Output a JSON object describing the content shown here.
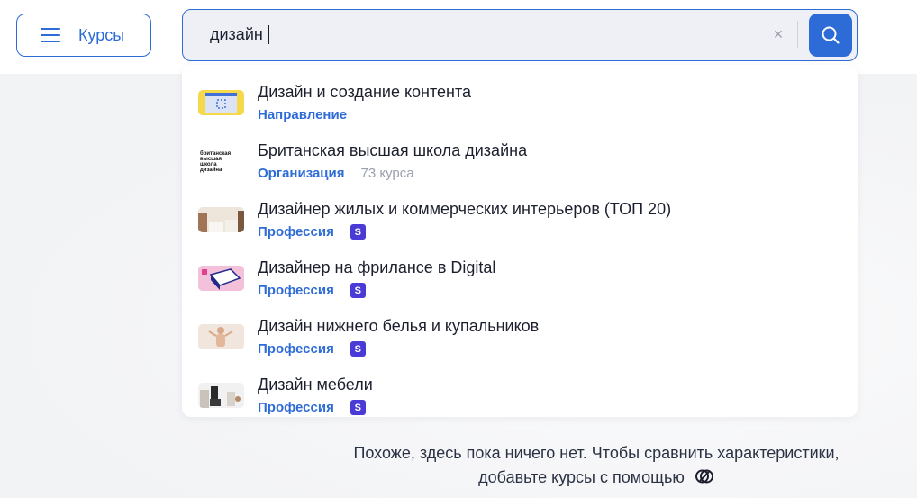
{
  "header": {
    "menu_button_label": "Курсы",
    "search": {
      "value": "дизайн",
      "placeholder": ""
    },
    "clear_symbol": "×"
  },
  "suggestions": [
    {
      "title": "Дизайн и создание контента",
      "type": "Направление",
      "count": "",
      "badge": ""
    },
    {
      "title": "Британская высшая школа дизайна",
      "type": "Организация",
      "count": "73 курса",
      "badge": "",
      "logo_text": "британская высшая школа дизайна"
    },
    {
      "title": "Дизайнер жилых и коммерческих интерьеров (ТОП 20)",
      "type": "Профессия",
      "count": "",
      "badge": "S"
    },
    {
      "title": "Дизайнер на фрилансе в Digital",
      "type": "Профессия",
      "count": "",
      "badge": "S"
    },
    {
      "title": "Дизайн нижнего белья и купальников",
      "type": "Профессия",
      "count": "",
      "badge": "S"
    },
    {
      "title": "Дизайн мебели",
      "type": "Профессия",
      "count": "",
      "badge": "S"
    }
  ],
  "empty_state": {
    "line1": "Похоже, здесь пока ничего нет. Чтобы сравнить характеристики,",
    "line2": "добавьте курсы с помощью"
  },
  "colors": {
    "accent": "#2d6cd6",
    "badge": "#4a3bd6",
    "muted": "#9aa0ad"
  },
  "icons": {
    "menu": "hamburger-icon",
    "search": "magnifier-icon",
    "clear": "close-icon",
    "compare": "compare-icon"
  }
}
